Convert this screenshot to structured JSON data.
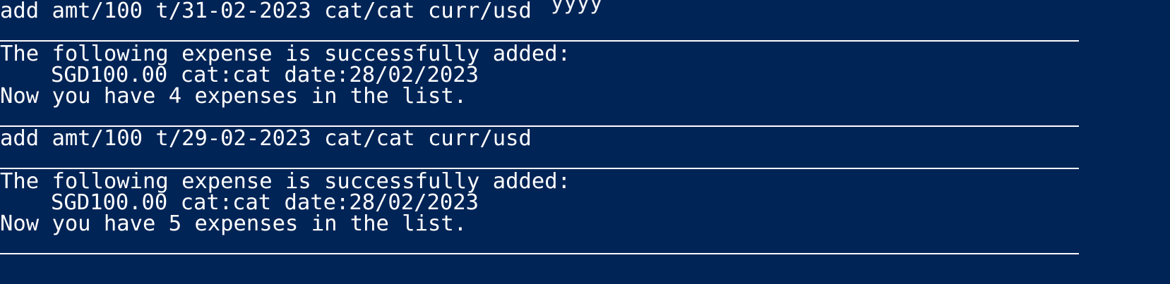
{
  "terminal": {
    "background": "#012456",
    "foreground": "#ffffff",
    "partial_top_text": "yyyy",
    "blocks": [
      {
        "command": "add amt/100 t/31-02-2023 cat/cat curr/usd",
        "response_line_1": "The following expense is successfully added:",
        "response_line_2": "SGD100.00 cat:cat date:28/02/2023",
        "response_line_3": "Now you have 4 expenses in the list."
      },
      {
        "command": "add amt/100 t/29-02-2023 cat/cat curr/usd",
        "response_line_1": "The following expense is successfully added:",
        "response_line_2": "SGD100.00 cat:cat date:28/02/2023",
        "response_line_3": "Now you have 5 expenses in the list."
      }
    ]
  }
}
